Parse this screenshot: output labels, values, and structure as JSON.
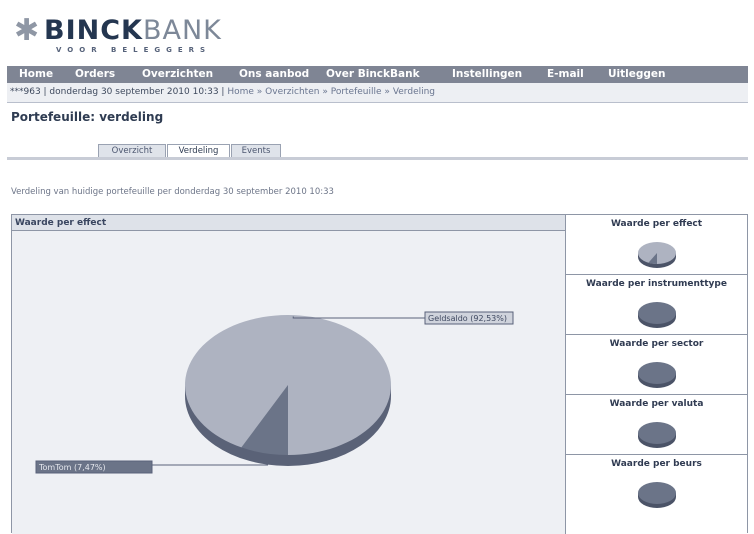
{
  "brand": {
    "star": "✱",
    "name_bold": "BINCK",
    "name_light": "BANK",
    "tagline": "VOOR BELEGGERS"
  },
  "nav": {
    "items": [
      "Home",
      "Orders",
      "Overzichten",
      "Ons aanbod",
      "Over BinckBank",
      "Instellingen",
      "E-mail",
      "Uitleggen"
    ]
  },
  "breadcrumb": {
    "prefix": "***963 | donderdag 30 september 2010 10:33 | ",
    "links": [
      "Home",
      "Overzichten",
      "Portefeuille",
      "Verdeling"
    ],
    "separator": "»"
  },
  "page": {
    "title": "Portefeuille: verdeling"
  },
  "tabs": {
    "items": [
      "Overzicht",
      "Verdeling",
      "Events"
    ],
    "active": "Verdeling"
  },
  "subtitle": "Verdeling van huidige portefeuille per donderdag 30 september 2010 10:33",
  "chart_panel": {
    "header": "Waarde per effect"
  },
  "chart_data": {
    "type": "pie",
    "title": "Waarde per effect",
    "slices": [
      {
        "label": "Geldsaldo (92,53%)",
        "value": 92.53,
        "color": "#aeb3c1"
      },
      {
        "label": "TomTom (7,47%)",
        "value": 7.47,
        "color": "#6b7488"
      }
    ]
  },
  "thumbnails": [
    {
      "label": "Waarde per effect"
    },
    {
      "label": "Waarde per instrumenttype"
    },
    {
      "label": "Waarde per sector"
    },
    {
      "label": "Waarde per valuta"
    },
    {
      "label": "Waarde per beurs"
    }
  ],
  "colors": {
    "nav_bg": "#7f8594",
    "pie_main": "#aeb3c1",
    "pie_slice": "#6b7488",
    "pie_side": "#5a6277",
    "thumb_pie": "#6b7488"
  }
}
